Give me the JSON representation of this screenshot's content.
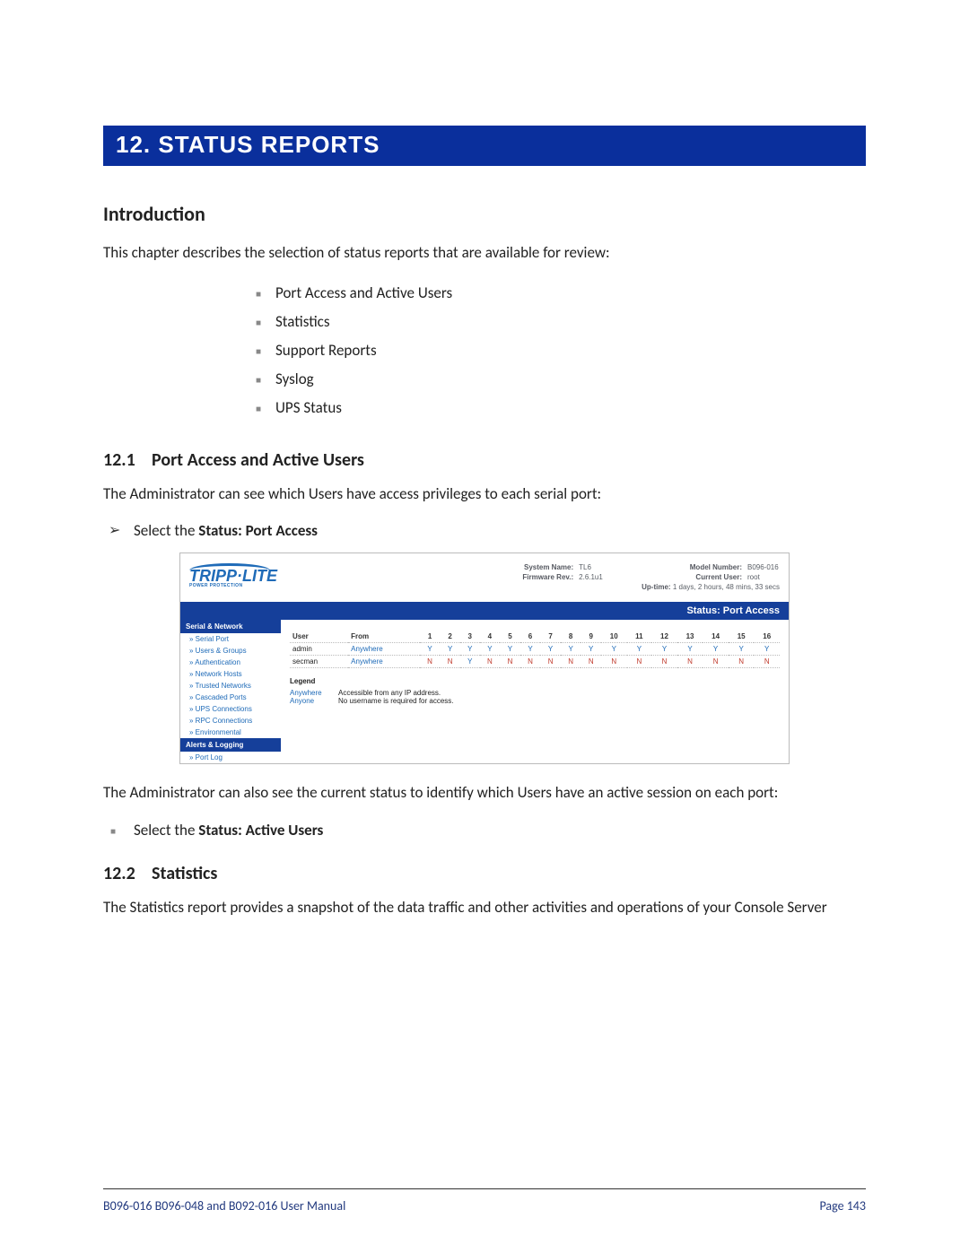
{
  "chapter_title": "12.  STATUS REPORTS",
  "intro": {
    "heading": "Introduction",
    "text": "This chapter describes the selection of status reports that are available for review:",
    "items": [
      "Port Access and Active Users",
      "Statistics",
      "Support Reports",
      "Syslog",
      "UPS Status"
    ]
  },
  "sections": {
    "s1": {
      "num": "12.1",
      "title": "Port Access and Active Users"
    },
    "s2": {
      "num": "12.2",
      "title": "Statistics"
    }
  },
  "s1": {
    "para1": "The Administrator can see which Users have access privileges to each serial port:",
    "step1_a": "Select the ",
    "step1_b": "Status: Port Access",
    "para2": "The Administrator can also see the current status to identify which Users have an active session on each port:",
    "step2_a": "Select the ",
    "step2_b": "Status: Active Users"
  },
  "s2": {
    "para": "The Statistics report provides a snapshot of the data traffic and other activities and operations of your Console Server"
  },
  "shot": {
    "logo_name": "TRIPP·LITE",
    "logo_tag": "POWER PROTECTION",
    "sys": {
      "sn_label": "System Name:",
      "sn_val": "TL6",
      "fr_label": "Firmware Rev.:",
      "fr_val": "2.6.1u1",
      "mn_label": "Model Number:",
      "mn_val": "B096-016",
      "cu_label": "Current User:",
      "cu_val": "root",
      "up_label": "Up-time:",
      "up_val": "1 days, 2 hours, 48 mins, 33 secs"
    },
    "status_bar": "Status: Port Access",
    "side": {
      "group1": "Serial & Network",
      "items1": [
        "Serial Port",
        "Users & Groups",
        "Authentication",
        "Network Hosts",
        "Trusted Networks",
        "Cascaded Ports",
        "UPS Connections",
        "RPC Connections",
        "Environmental"
      ],
      "group2": "Alerts & Logging",
      "items2": [
        "Port Log"
      ]
    },
    "table": {
      "headers": [
        "User",
        "From",
        "1",
        "2",
        "3",
        "4",
        "5",
        "6",
        "7",
        "8",
        "9",
        "10",
        "11",
        "12",
        "13",
        "14",
        "15",
        "16"
      ],
      "rows": [
        {
          "user": "admin",
          "from": "Anywhere",
          "cells": [
            "Y",
            "Y",
            "Y",
            "Y",
            "Y",
            "Y",
            "Y",
            "Y",
            "Y",
            "Y",
            "Y",
            "Y",
            "Y",
            "Y",
            "Y",
            "Y"
          ]
        },
        {
          "user": "secman",
          "from": "Anywhere",
          "cells": [
            "N",
            "N",
            "Y",
            "N",
            "N",
            "N",
            "N",
            "N",
            "N",
            "N",
            "N",
            "N",
            "N",
            "N",
            "N",
            "N"
          ]
        }
      ]
    },
    "legend": {
      "title": "Legend",
      "rows": [
        {
          "key": "Anywhere",
          "desc": "Accessible from any IP address."
        },
        {
          "key": "Anyone",
          "desc": "No username is required for access."
        }
      ]
    }
  },
  "footer": {
    "left": "B096-016 B096-048 and B092-016 User Manual",
    "right": "Page 143"
  }
}
